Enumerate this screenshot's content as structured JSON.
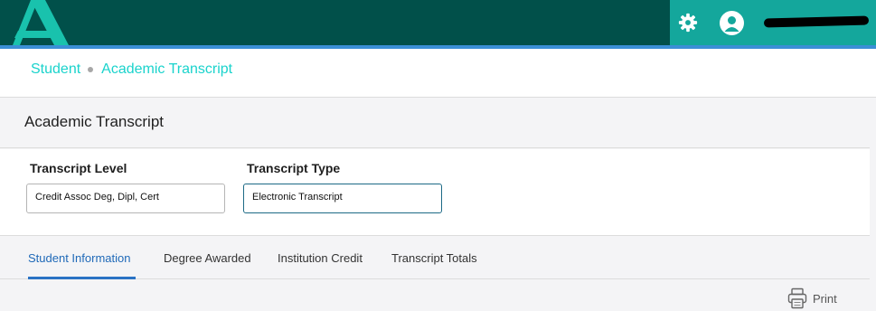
{
  "header": {
    "logo_icon": "brand-logo-icon",
    "settings_icon": "gear-icon",
    "avatar_icon": "user-avatar-icon",
    "colors": {
      "bar": "#01504a",
      "accent_block": "#14a79c",
      "stripe": "#3b8fd6"
    }
  },
  "breadcrumb": {
    "items": [
      "Student",
      "Academic Transcript"
    ],
    "color": "#1ad3cc"
  },
  "page": {
    "title": "Academic Transcript"
  },
  "form": {
    "level_label": "Transcript Level",
    "level_value": "Credit Assoc Deg, Dipl, Cert",
    "type_label": "Transcript Type",
    "type_value": "Electronic Transcript"
  },
  "tabs": [
    {
      "label": "Student Information",
      "active": true
    },
    {
      "label": "Degree Awarded",
      "active": false
    },
    {
      "label": "Institution Credit",
      "active": false
    },
    {
      "label": "Transcript Totals",
      "active": false
    }
  ],
  "actions": {
    "print_label": "Print",
    "print_icon": "printer-icon"
  }
}
